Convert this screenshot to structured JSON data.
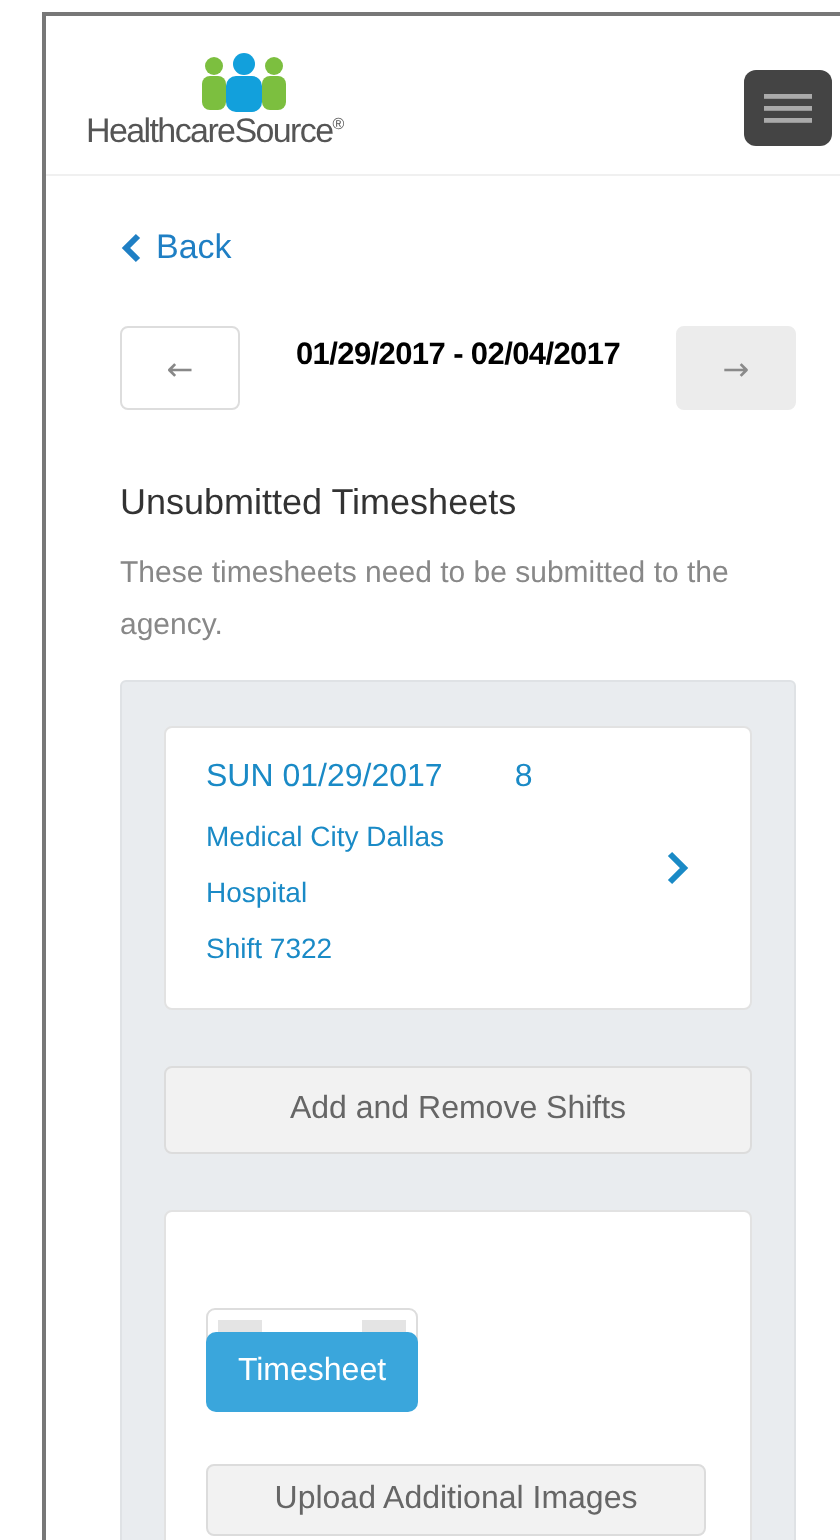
{
  "header": {
    "logo_text": "HealthcareSource$^{®}$"
  },
  "back_link": "Back",
  "week_nav": {
    "prev": {
      "label": "←",
      "disabled": false
    },
    "range": "01/29/2017 - 02/04/2017",
    "next": {
      "label": "→",
      "disabled": true
    }
  },
  "section": {
    "title": "Unsubmitted Timesheets",
    "description": "These timesheets need to be submitted to the agency."
  },
  "shifts": [
    {
      "day_date": "SUN 01/29/2017",
      "hours": "8",
      "location": "Medical City Dallas Hospital",
      "shift": "Shift 7322"
    }
  ],
  "add_remove_button": "Add and Remove Shifts",
  "upload": {
    "image_button": "Timesheet",
    "more_button": "Upload Additional Images"
  }
}
